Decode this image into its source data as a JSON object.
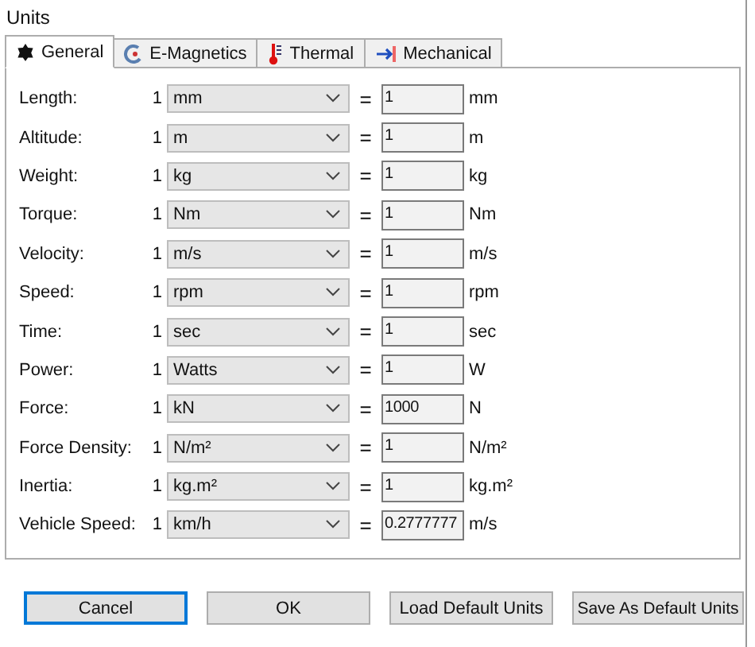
{
  "window": {
    "title": "Units"
  },
  "tabs": [
    {
      "label": "General",
      "selected": true,
      "kind": "general"
    },
    {
      "label": "E-Magnetics",
      "selected": false,
      "kind": "magnet"
    },
    {
      "label": "Thermal",
      "selected": false,
      "kind": "thermal"
    },
    {
      "label": "Mechanical",
      "selected": false,
      "kind": "mechanical"
    }
  ],
  "units": [
    {
      "label": "Length:",
      "factor": "1",
      "unit": "mm",
      "value": "1",
      "base": "mm"
    },
    {
      "label": "Altitude:",
      "factor": "1",
      "unit": "m",
      "value": "1",
      "base": "m"
    },
    {
      "label": "Weight:",
      "factor": "1",
      "unit": "kg",
      "value": "1",
      "base": "kg"
    },
    {
      "label": "Torque:",
      "factor": "1",
      "unit": "Nm",
      "value": "1",
      "base": "Nm"
    },
    {
      "label": "Velocity:",
      "factor": "1",
      "unit": "m/s",
      "value": "1",
      "base": "m/s"
    },
    {
      "label": "Speed:",
      "factor": "1",
      "unit": "rpm",
      "value": "1",
      "base": "rpm"
    },
    {
      "label": "Time:",
      "factor": "1",
      "unit": "sec",
      "value": "1",
      "base": "sec"
    },
    {
      "label": "Power:",
      "factor": "1",
      "unit": "Watts",
      "value": "1",
      "base": "W"
    },
    {
      "label": "Force:",
      "factor": "1",
      "unit": "kN",
      "value": "1000",
      "base": "N"
    },
    {
      "label": "Force Density:",
      "factor": "1",
      "unit": "N/m²",
      "value": "1",
      "base": "N/m²"
    },
    {
      "label": "Inertia:",
      "factor": "1",
      "unit": "kg.m²",
      "value": "1",
      "base": "kg.m²"
    },
    {
      "label": "Vehicle Speed:",
      "factor": "1",
      "unit": "km/h",
      "value": "0.2777777",
      "base": "m/s"
    }
  ],
  "equals": "=",
  "buttons": [
    {
      "label": "Cancel",
      "focused": true
    },
    {
      "label": "OK",
      "focused": false
    },
    {
      "label": "Load Default Units",
      "focused": false
    },
    {
      "label": "Save As Default Units",
      "focused": false
    }
  ]
}
